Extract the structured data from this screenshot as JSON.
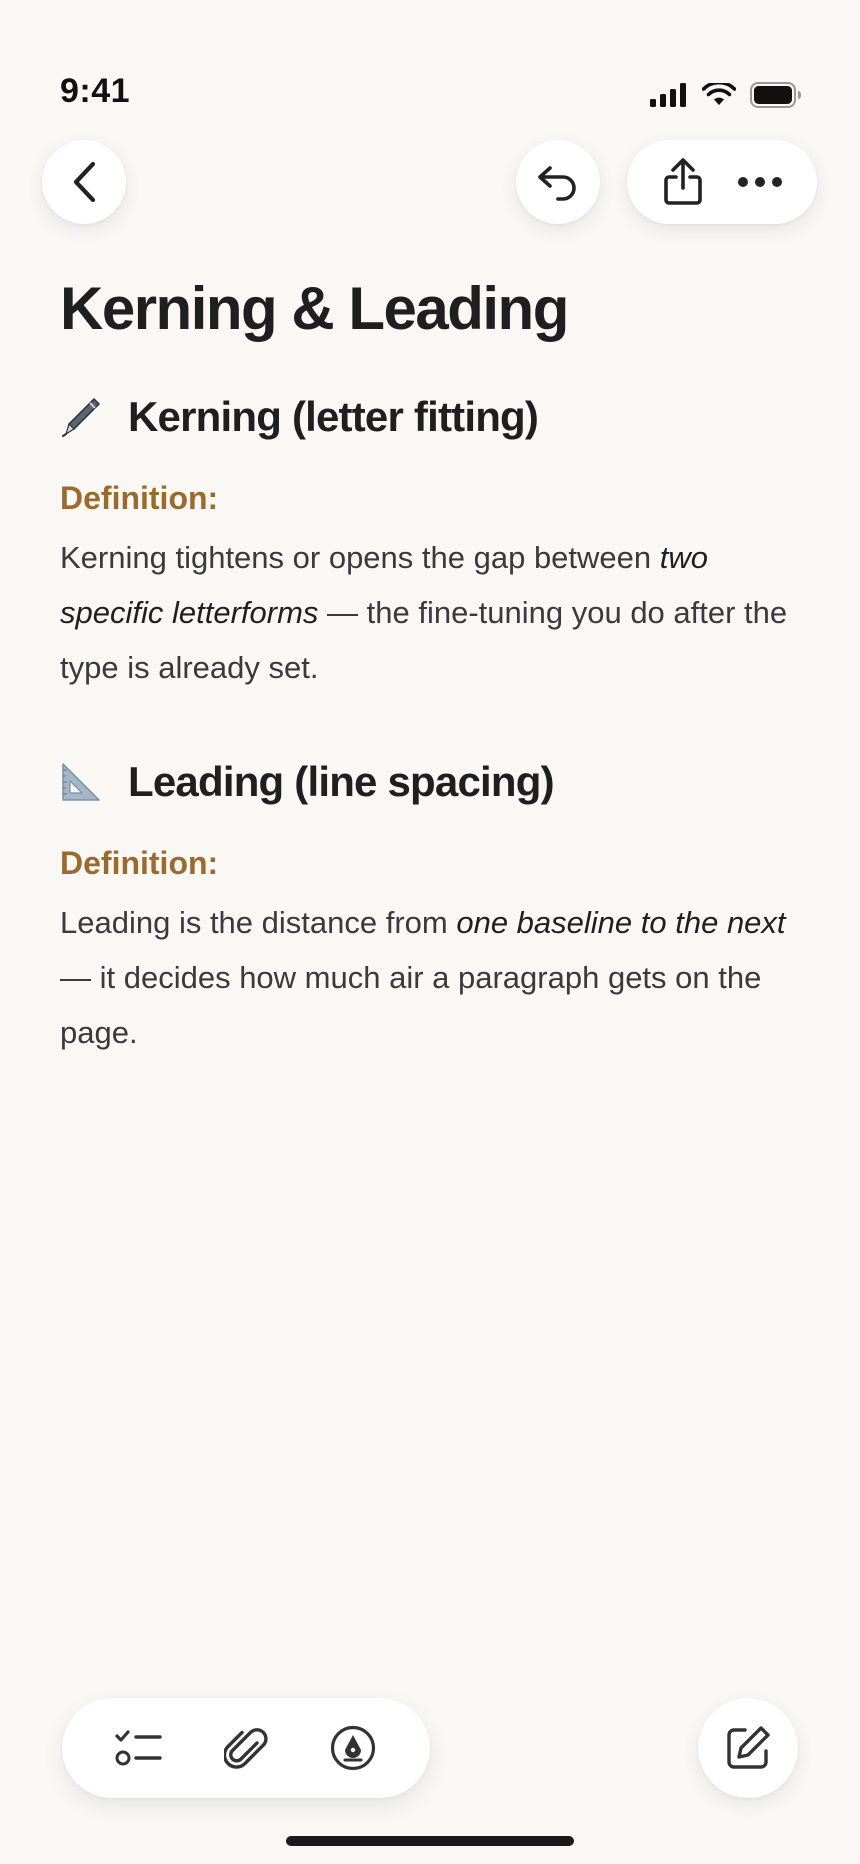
{
  "status_bar": {
    "time": "9:41"
  },
  "nav": {
    "back_icon": "chevron-left-icon",
    "undo_icon": "undo-icon",
    "share_icon": "share-icon",
    "more_icon": "more-icon"
  },
  "note": {
    "title": "Kerning & Leading",
    "sections": [
      {
        "emoji": "pen-icon",
        "heading": "Kerning (letter fitting)",
        "definition_label": "Definition:",
        "body_pre": "Kerning tightens or opens the gap between ",
        "body_em": "two specific letterforms",
        "body_post": " — the fine-tuning you do after the type is already set."
      },
      {
        "emoji": "triangle-ruler-icon",
        "heading": "Leading (line spacing)",
        "definition_label": "Definition:",
        "body_pre": "Leading is the distance from ",
        "body_em": "one baseline to the next",
        "body_post": " — it decides how much air a paragraph gets on the page."
      }
    ]
  },
  "toolbar": {
    "checklist_icon": "checklist-icon",
    "attachment_icon": "paperclip-icon",
    "markup_icon": "pen-tip-icon",
    "compose_icon": "compose-icon"
  },
  "colors": {
    "background": "#faf8f5",
    "accent_label": "#9a6a2e",
    "text": "#3a3a3a"
  }
}
